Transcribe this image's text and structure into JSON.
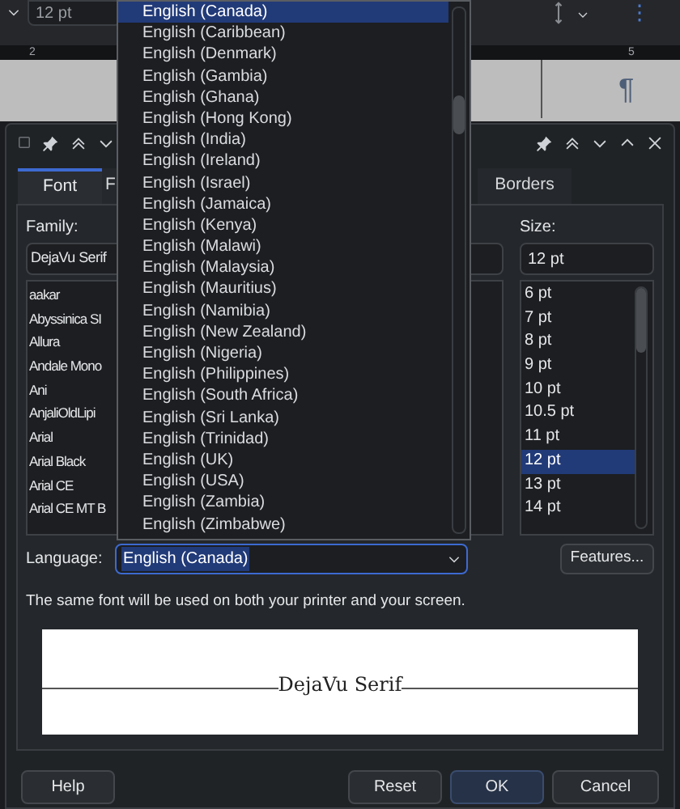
{
  "toolbar": {
    "font_size": "12 pt"
  },
  "ruler": {
    "marks": [
      "2",
      "5"
    ]
  },
  "document": {
    "mark": "¶"
  },
  "dialog": {
    "tabs": [
      {
        "label": "Font",
        "selected": true
      },
      {
        "label": "F",
        "selected": false
      },
      {
        "label": "Borders",
        "selected": false
      }
    ],
    "family": {
      "label": "Family:",
      "value": "DejaVu Serif",
      "items": [
        "aakar",
        "Abyssinica SI",
        "Allura",
        "Andale Mono",
        "Ani",
        "AnjaliOldLipi",
        "Arial",
        "Arial Black",
        "Arial CE",
        "Arial CE MT B"
      ]
    },
    "size": {
      "label": "Size:",
      "value": "12 pt",
      "items": [
        {
          "label": "6 pt",
          "selected": false
        },
        {
          "label": "7 pt",
          "selected": false
        },
        {
          "label": "8 pt",
          "selected": false
        },
        {
          "label": "9 pt",
          "selected": false
        },
        {
          "label": "10 pt",
          "selected": false
        },
        {
          "label": "10.5 pt",
          "selected": false
        },
        {
          "label": "11 pt",
          "selected": false
        },
        {
          "label": "12 pt",
          "selected": true
        },
        {
          "label": "13 pt",
          "selected": false
        },
        {
          "label": "14 pt",
          "selected": false
        }
      ]
    },
    "language": {
      "label": "Language:",
      "value": "English (Canada)"
    },
    "features_button": "Features...",
    "note": "The same font will be used on both your printer and your screen.",
    "preview": "DejaVu Serif",
    "buttons": [
      {
        "label": "Help",
        "default": false
      },
      {
        "label": "Reset",
        "default": false
      },
      {
        "label": "OK",
        "default": true
      },
      {
        "label": "Cancel",
        "default": false
      }
    ]
  },
  "language_dropdown": {
    "items": [
      {
        "label": "English (Canada)",
        "selected": true
      },
      {
        "label": "English (Caribbean)",
        "selected": false
      },
      {
        "label": "English (Denmark)",
        "selected": false
      },
      {
        "label": "English (Gambia)",
        "selected": false
      },
      {
        "label": "English (Ghana)",
        "selected": false
      },
      {
        "label": "English (Hong Kong)",
        "selected": false
      },
      {
        "label": "English (India)",
        "selected": false
      },
      {
        "label": "English (Ireland)",
        "selected": false
      },
      {
        "label": "English (Israel)",
        "selected": false
      },
      {
        "label": "English (Jamaica)",
        "selected": false
      },
      {
        "label": "English (Kenya)",
        "selected": false
      },
      {
        "label": "English (Malawi)",
        "selected": false
      },
      {
        "label": "English (Malaysia)",
        "selected": false
      },
      {
        "label": "English (Mauritius)",
        "selected": false
      },
      {
        "label": "English (Namibia)",
        "selected": false
      },
      {
        "label": "English (New Zealand)",
        "selected": false
      },
      {
        "label": "English (Nigeria)",
        "selected": false
      },
      {
        "label": "English (Philippines)",
        "selected": false
      },
      {
        "label": "English (South Africa)",
        "selected": false
      },
      {
        "label": "English (Sri Lanka)",
        "selected": false
      },
      {
        "label": "English (Trinidad)",
        "selected": false
      },
      {
        "label": "English (UK)",
        "selected": false
      },
      {
        "label": "English (USA)",
        "selected": false
      },
      {
        "label": "English (Zambia)",
        "selected": false
      },
      {
        "label": "English (Zimbabwe)",
        "selected": false
      }
    ]
  }
}
